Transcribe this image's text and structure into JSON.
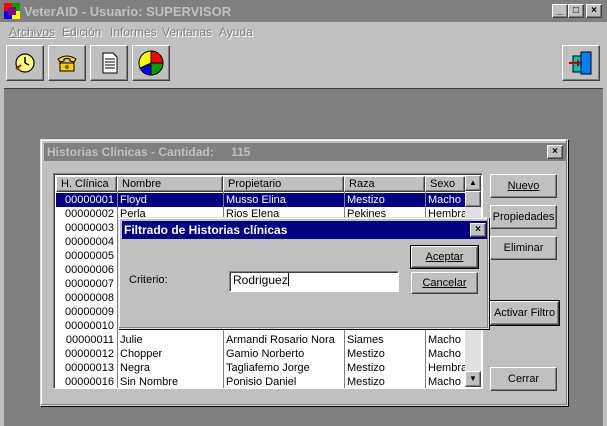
{
  "app": {
    "title": "VeterAID - Usuario: SUPERVISOR",
    "window_buttons": {
      "minimize": "_",
      "maximize": "□",
      "close": "×"
    }
  },
  "menu": [
    {
      "label": "Archivos",
      "accel_index": 0
    },
    {
      "label": "Edición",
      "accel_index": 0
    },
    {
      "label": "Informes",
      "accel_index": 0
    },
    {
      "label": "Ventanas",
      "accel_index": 0
    },
    {
      "label": "Ayuda",
      "accel_index": 1
    }
  ],
  "toolbar": [
    {
      "icon": "clock-icon"
    },
    {
      "icon": "telephone-icon"
    },
    {
      "icon": "document-icon"
    },
    {
      "icon": "pie-chart-icon"
    },
    {
      "icon": "exit-door-icon"
    }
  ],
  "historias": {
    "title": "Historias Clínicas - Cantidad:",
    "count": "115",
    "columns": [
      "H. Clínica",
      "Nombre",
      "Propietario",
      "Raza",
      "Sexo"
    ],
    "rows": [
      {
        "id": "00000001",
        "nombre": "Floyd",
        "propietario": "Musso Elina",
        "raza": "Mestizo",
        "sexo": "Macho",
        "selected": true
      },
      {
        "id": "00000002",
        "nombre": "Perla",
        "propietario": "Rios Elena",
        "raza": "Pekines",
        "sexo": "Hembra"
      },
      {
        "id": "00000003",
        "nombre": "",
        "propietario": "",
        "raza": "",
        "sexo": ""
      },
      {
        "id": "00000004",
        "nombre": "",
        "propietario": "",
        "raza": "",
        "sexo": ""
      },
      {
        "id": "00000005",
        "nombre": "",
        "propietario": "",
        "raza": "",
        "sexo": ""
      },
      {
        "id": "00000006",
        "nombre": "",
        "propietario": "",
        "raza": "",
        "sexo": ""
      },
      {
        "id": "00000007",
        "nombre": "",
        "propietario": "",
        "raza": "",
        "sexo": ""
      },
      {
        "id": "00000008",
        "nombre": "",
        "propietario": "",
        "raza": "",
        "sexo": ""
      },
      {
        "id": "00000009",
        "nombre": "",
        "propietario": "",
        "raza": "",
        "sexo": ""
      },
      {
        "id": "00000010",
        "nombre": "",
        "propietario": "",
        "raza": "",
        "sexo": ""
      },
      {
        "id": "00000011",
        "nombre": "Julie",
        "propietario": "Armandi  Rosario Nora",
        "raza": "Siames",
        "sexo": "Macho"
      },
      {
        "id": "00000012",
        "nombre": "Chopper",
        "propietario": "Gamio  Norberto",
        "raza": "Mestizo",
        "sexo": "Macho"
      },
      {
        "id": "00000013",
        "nombre": "Negra",
        "propietario": "Tagliafemo  Jorge",
        "raza": "Mestizo",
        "sexo": "Hembra"
      },
      {
        "id": "00000016",
        "nombre": "Sin Nombre",
        "propietario": "Ponisio   Daniel",
        "raza": "Mestizo",
        "sexo": "Macho"
      }
    ],
    "buttons": {
      "nuevo": "Nuevo",
      "propiedades": "Propiedades",
      "eliminar": "Eliminar",
      "activar_filtro": "Activar Filtro",
      "cerrar": "Cerrar"
    }
  },
  "filter_dialog": {
    "title": "Filtrado de Historias clínicas",
    "criterio_label": "Criterio:",
    "criterio_value": "Rodriguez",
    "aceptar": "Aceptar",
    "cancelar": "Cancelar"
  }
}
